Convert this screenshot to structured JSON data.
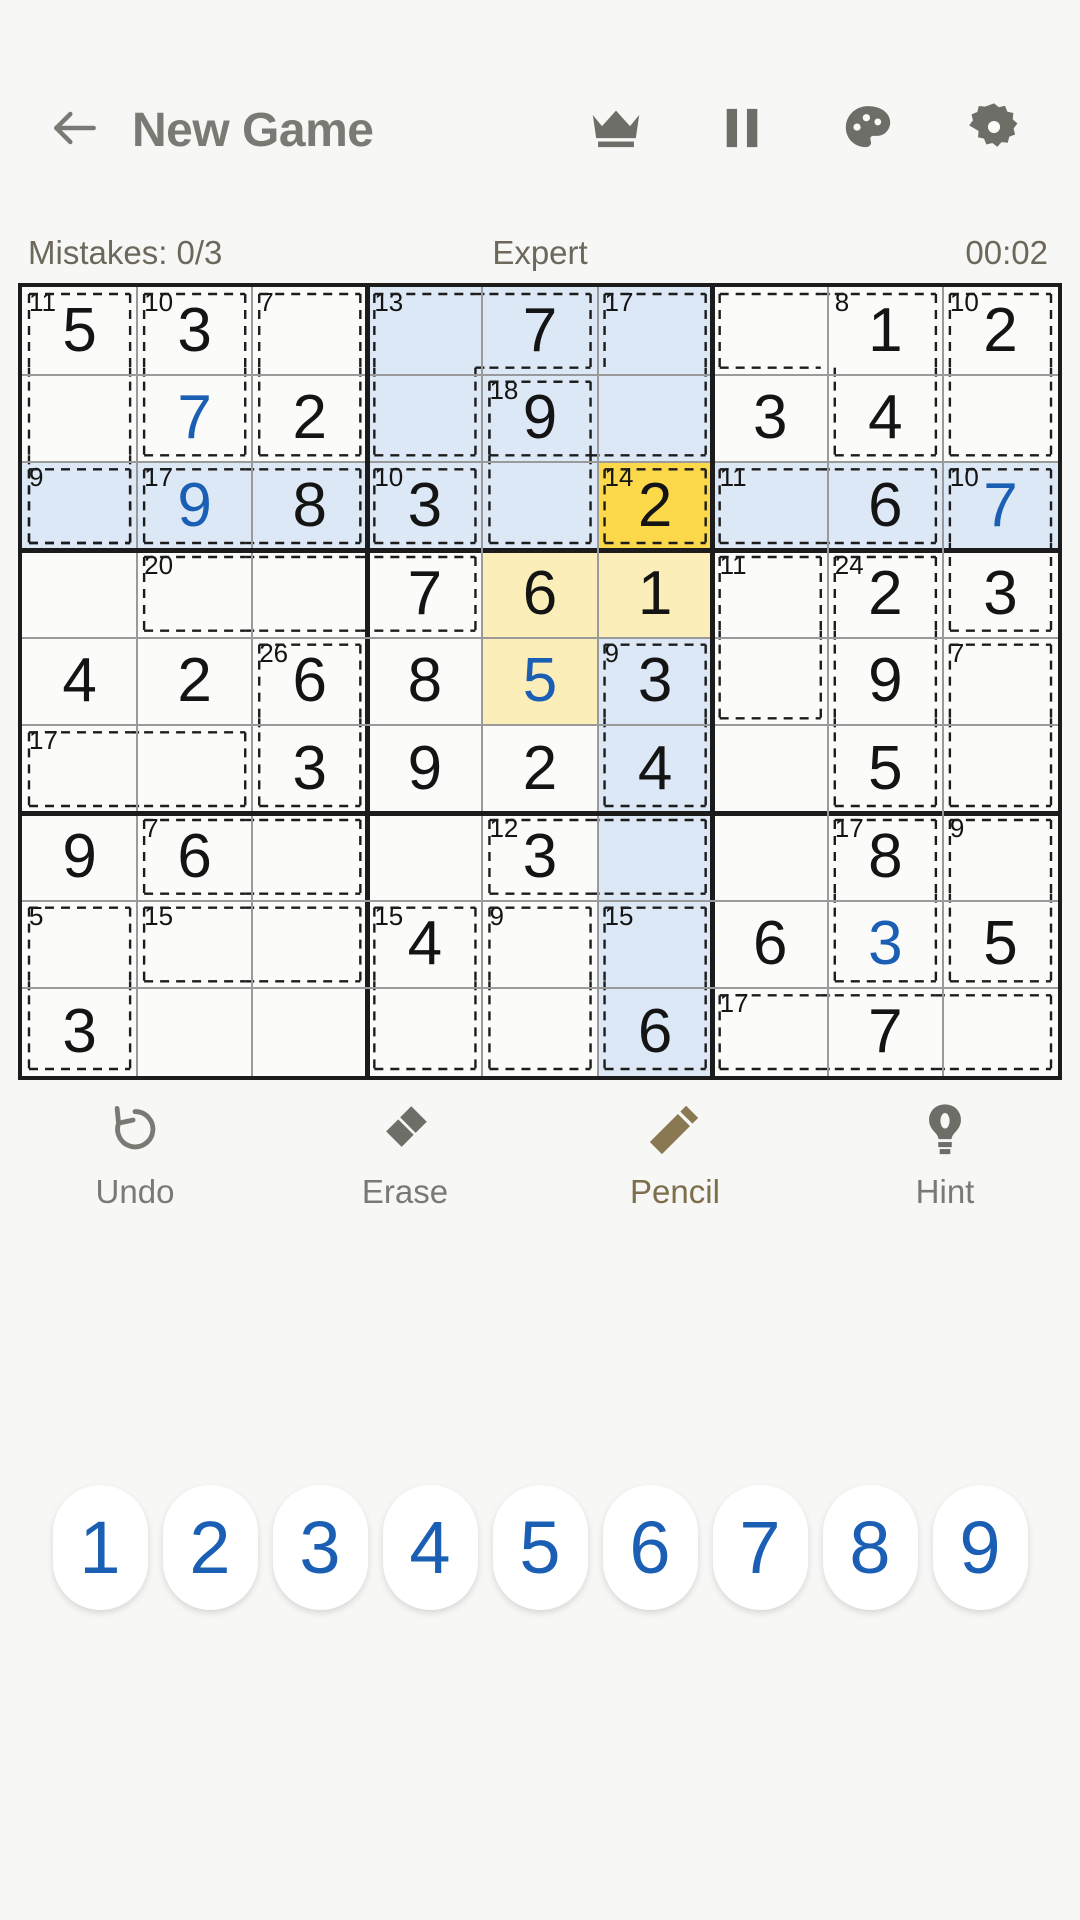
{
  "appbar": {
    "back_icon": "arrow-left-icon",
    "title": "New Game",
    "icons": [
      {
        "name": "crown-icon",
        "label": "Crown"
      },
      {
        "name": "pause-icon",
        "label": "Pause"
      },
      {
        "name": "palette-icon",
        "label": "Theme"
      },
      {
        "name": "gear-icon",
        "label": "Settings"
      }
    ]
  },
  "status": {
    "mistakes": "Mistakes: 0/3",
    "difficulty": "Expert",
    "timer": "00:02"
  },
  "colors": {
    "accent_blue": "#1a5fb4",
    "selected_cell": "#fcd94a",
    "cage_highlight": "#fbeeb8",
    "peer_highlight": "#dce8f5",
    "grid_line": "#9a9a9a",
    "grid_bold": "#1c1c1c",
    "board_bg": "#fbfbfa",
    "page_bg": "#f7f7f5",
    "text_muted": "#7a7a74"
  },
  "board": {
    "size": 9,
    "selected": {
      "row": 2,
      "col": 5,
      "value": "2"
    },
    "values": [
      [
        "5",
        "3",
        "",
        "",
        "7",
        "",
        "",
        "1",
        "2"
      ],
      [
        "",
        "7",
        "2",
        "",
        "9",
        "",
        "3",
        "4",
        ""
      ],
      [
        "",
        "9",
        "8",
        "3",
        "",
        "2",
        "",
        "6",
        "7"
      ],
      [
        "",
        "",
        "",
        "7",
        "6",
        "1",
        "",
        "2",
        "3"
      ],
      [
        "4",
        "2",
        "6",
        "8",
        "5",
        "3",
        "",
        "9",
        ""
      ],
      [
        "",
        "",
        "3",
        "9",
        "2",
        "4",
        "",
        "5",
        ""
      ],
      [
        "9",
        "6",
        "",
        "",
        "3",
        "",
        "",
        "8",
        ""
      ],
      [
        "",
        "",
        "",
        "4",
        "",
        "",
        "6",
        "3",
        "5"
      ],
      [
        "3",
        "",
        "",
        "",
        "",
        "6",
        "",
        "7",
        ""
      ]
    ],
    "user_entered": [
      [
        false,
        false,
        false,
        false,
        false,
        false,
        false,
        false,
        false
      ],
      [
        false,
        true,
        false,
        false,
        false,
        false,
        false,
        false,
        false
      ],
      [
        false,
        true,
        false,
        false,
        false,
        false,
        false,
        false,
        true
      ],
      [
        false,
        false,
        false,
        false,
        false,
        false,
        false,
        false,
        false
      ],
      [
        false,
        false,
        false,
        false,
        true,
        false,
        false,
        false,
        false
      ],
      [
        false,
        false,
        false,
        false,
        false,
        false,
        false,
        false,
        false
      ],
      [
        false,
        false,
        false,
        false,
        false,
        false,
        false,
        false,
        false
      ],
      [
        false,
        false,
        false,
        false,
        false,
        false,
        false,
        true,
        false
      ],
      [
        false,
        false,
        false,
        false,
        false,
        false,
        false,
        false,
        false
      ]
    ],
    "highlight_peer": [
      [
        false,
        false,
        false,
        true,
        true,
        true,
        false,
        false,
        false
      ],
      [
        false,
        false,
        false,
        true,
        true,
        true,
        false,
        false,
        false
      ],
      [
        true,
        true,
        true,
        true,
        true,
        false,
        true,
        true,
        true
      ],
      [
        false,
        false,
        false,
        false,
        false,
        false,
        false,
        false,
        false
      ],
      [
        false,
        false,
        false,
        false,
        false,
        true,
        false,
        false,
        false
      ],
      [
        false,
        false,
        false,
        false,
        false,
        true,
        false,
        false,
        false
      ],
      [
        false,
        false,
        false,
        false,
        false,
        true,
        false,
        false,
        false
      ],
      [
        false,
        false,
        false,
        false,
        false,
        true,
        false,
        false,
        false
      ],
      [
        false,
        false,
        false,
        false,
        false,
        true,
        false,
        false,
        false
      ]
    ],
    "highlight_cage": [
      [
        false,
        false,
        false,
        false,
        false,
        false,
        false,
        false,
        false
      ],
      [
        false,
        false,
        false,
        false,
        false,
        false,
        false,
        false,
        false
      ],
      [
        false,
        false,
        false,
        false,
        false,
        false,
        false,
        false,
        false
      ],
      [
        false,
        false,
        false,
        false,
        true,
        true,
        false,
        false,
        false
      ],
      [
        false,
        false,
        false,
        false,
        true,
        false,
        false,
        false,
        false
      ],
      [
        false,
        false,
        false,
        false,
        false,
        false,
        false,
        false,
        false
      ],
      [
        false,
        false,
        false,
        false,
        false,
        false,
        false,
        false,
        false
      ],
      [
        false,
        false,
        false,
        false,
        false,
        false,
        false,
        false,
        false
      ],
      [
        false,
        false,
        false,
        false,
        false,
        false,
        false,
        false,
        false
      ]
    ],
    "cage_sums": [
      {
        "row": 0,
        "col": 0,
        "sum": "11"
      },
      {
        "row": 0,
        "col": 1,
        "sum": "10"
      },
      {
        "row": 0,
        "col": 2,
        "sum": "7"
      },
      {
        "row": 0,
        "col": 3,
        "sum": "13"
      },
      {
        "row": 0,
        "col": 5,
        "sum": "17"
      },
      {
        "row": 0,
        "col": 7,
        "sum": "8"
      },
      {
        "row": 0,
        "col": 8,
        "sum": "10"
      },
      {
        "row": 1,
        "col": 4,
        "sum": "18"
      },
      {
        "row": 2,
        "col": 0,
        "sum": "9"
      },
      {
        "row": 2,
        "col": 1,
        "sum": "17"
      },
      {
        "row": 2,
        "col": 3,
        "sum": "10"
      },
      {
        "row": 2,
        "col": 5,
        "sum": "14"
      },
      {
        "row": 2,
        "col": 6,
        "sum": "11"
      },
      {
        "row": 2,
        "col": 8,
        "sum": "10"
      },
      {
        "row": 3,
        "col": 1,
        "sum": "20"
      },
      {
        "row": 3,
        "col": 6,
        "sum": "11"
      },
      {
        "row": 3,
        "col": 7,
        "sum": "24"
      },
      {
        "row": 4,
        "col": 2,
        "sum": "26"
      },
      {
        "row": 4,
        "col": 5,
        "sum": "9"
      },
      {
        "row": 4,
        "col": 8,
        "sum": "7"
      },
      {
        "row": 5,
        "col": 0,
        "sum": "17"
      },
      {
        "row": 6,
        "col": 1,
        "sum": "7"
      },
      {
        "row": 6,
        "col": 4,
        "sum": "12"
      },
      {
        "row": 6,
        "col": 7,
        "sum": "17"
      },
      {
        "row": 6,
        "col": 8,
        "sum": "9"
      },
      {
        "row": 7,
        "col": 0,
        "sum": "5"
      },
      {
        "row": 7,
        "col": 1,
        "sum": "15"
      },
      {
        "row": 7,
        "col": 3,
        "sum": "15"
      },
      {
        "row": 7,
        "col": 4,
        "sum": "9"
      },
      {
        "row": 7,
        "col": 5,
        "sum": "15"
      },
      {
        "row": 8,
        "col": 6,
        "sum": "17"
      }
    ],
    "cages": [
      {
        "sum": "11",
        "cells": [
          [
            0,
            0
          ],
          [
            1,
            0
          ],
          [
            2,
            0
          ]
        ]
      },
      {
        "sum": "10",
        "cells": [
          [
            0,
            1
          ],
          [
            1,
            1
          ]
        ]
      },
      {
        "sum": "7",
        "cells": [
          [
            0,
            2
          ],
          [
            1,
            2
          ]
        ]
      },
      {
        "sum": "13",
        "cells": [
          [
            0,
            3
          ],
          [
            0,
            4
          ],
          [
            1,
            3
          ]
        ]
      },
      {
        "sum": "17",
        "cells": [
          [
            0,
            5
          ],
          [
            1,
            5
          ],
          [
            1,
            4
          ]
        ]
      },
      {
        "sum": "8",
        "cells": [
          [
            0,
            6
          ],
          [
            0,
            7
          ],
          [
            1,
            7
          ]
        ]
      },
      {
        "sum": "10",
        "cells": [
          [
            0,
            8
          ],
          [
            1,
            8
          ]
        ]
      },
      {
        "sum": "18",
        "cells": [
          [
            1,
            4
          ],
          [
            2,
            4
          ]
        ]
      },
      {
        "sum": "9",
        "cells": [
          [
            2,
            0
          ]
        ]
      },
      {
        "sum": "17",
        "cells": [
          [
            2,
            1
          ],
          [
            2,
            2
          ]
        ]
      },
      {
        "sum": "10",
        "cells": [
          [
            2,
            3
          ]
        ]
      },
      {
        "sum": "14",
        "cells": [
          [
            2,
            5
          ]
        ]
      },
      {
        "sum": "11",
        "cells": [
          [
            2,
            6
          ],
          [
            2,
            7
          ]
        ]
      },
      {
        "sum": "10",
        "cells": [
          [
            2,
            8
          ],
          [
            3,
            8
          ]
        ]
      },
      {
        "sum": "20",
        "cells": [
          [
            3,
            1
          ],
          [
            3,
            2
          ],
          [
            3,
            3
          ]
        ]
      },
      {
        "sum": "11",
        "cells": [
          [
            3,
            6
          ],
          [
            4,
            6
          ]
        ]
      },
      {
        "sum": "24",
        "cells": [
          [
            3,
            7
          ],
          [
            4,
            7
          ],
          [
            5,
            7
          ]
        ]
      },
      {
        "sum": "26",
        "cells": [
          [
            4,
            2
          ],
          [
            5,
            2
          ]
        ]
      },
      {
        "sum": "9",
        "cells": [
          [
            4,
            5
          ],
          [
            5,
            5
          ]
        ]
      },
      {
        "sum": "7",
        "cells": [
          [
            4,
            8
          ],
          [
            5,
            8
          ]
        ]
      },
      {
        "sum": "17",
        "cells": [
          [
            5,
            0
          ],
          [
            5,
            1
          ]
        ]
      },
      {
        "sum": "7",
        "cells": [
          [
            6,
            1
          ],
          [
            6,
            2
          ]
        ]
      },
      {
        "sum": "12",
        "cells": [
          [
            6,
            4
          ],
          [
            6,
            5
          ]
        ]
      },
      {
        "sum": "17",
        "cells": [
          [
            6,
            7
          ],
          [
            7,
            7
          ]
        ]
      },
      {
        "sum": "9",
        "cells": [
          [
            6,
            8
          ],
          [
            7,
            8
          ]
        ]
      },
      {
        "sum": "5",
        "cells": [
          [
            7,
            0
          ],
          [
            8,
            0
          ]
        ]
      },
      {
        "sum": "15",
        "cells": [
          [
            7,
            1
          ],
          [
            7,
            2
          ]
        ]
      },
      {
        "sum": "15",
        "cells": [
          [
            7,
            3
          ],
          [
            8,
            3
          ]
        ]
      },
      {
        "sum": "9",
        "cells": [
          [
            7,
            4
          ],
          [
            8,
            4
          ]
        ]
      },
      {
        "sum": "15",
        "cells": [
          [
            7,
            5
          ],
          [
            8,
            5
          ]
        ]
      },
      {
        "sum": "17",
        "cells": [
          [
            8,
            6
          ],
          [
            8,
            7
          ],
          [
            8,
            8
          ]
        ]
      }
    ]
  },
  "tools": [
    {
      "name": "undo-tool",
      "icon": "undo-icon",
      "label": "Undo"
    },
    {
      "name": "erase-tool",
      "icon": "eraser-icon",
      "label": "Erase"
    },
    {
      "name": "pencil-tool",
      "icon": "pencil-icon",
      "label": "Pencil"
    },
    {
      "name": "hint-tool",
      "icon": "bulb-icon",
      "label": "Hint"
    }
  ],
  "numpad": [
    "1",
    "2",
    "3",
    "4",
    "5",
    "6",
    "7",
    "8",
    "9"
  ]
}
